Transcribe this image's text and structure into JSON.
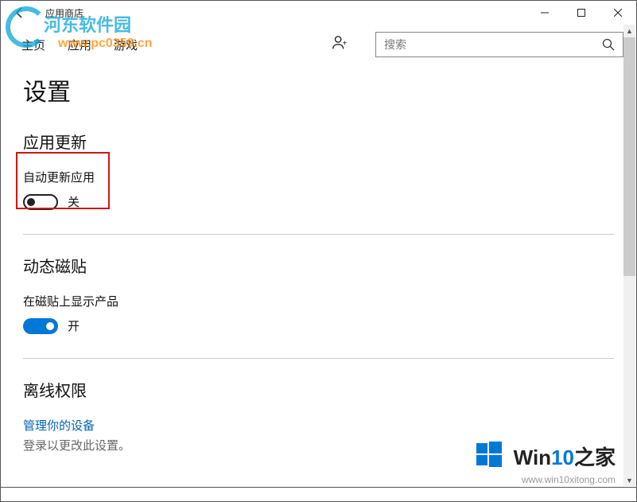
{
  "window": {
    "title": "应用商店"
  },
  "nav": {
    "home": "主页",
    "apps": "应用",
    "games": "游戏"
  },
  "search": {
    "placeholder": "搜索"
  },
  "page": {
    "title": "设置"
  },
  "sections": {
    "updates": {
      "title": "应用更新",
      "auto_update_label": "自动更新应用",
      "auto_update_state": "关"
    },
    "tiles": {
      "title": "动态磁贴",
      "show_products_label": "在磁贴上显示产品",
      "show_products_state": "开"
    },
    "offline": {
      "title": "离线权限",
      "manage_link": "管理你的设备",
      "signin_text": "登录以更改此设置。"
    }
  },
  "watermark_left": {
    "title": "河东软件园",
    "url": "www.pc0359.cn"
  },
  "watermark_right": {
    "title_pre": "Win",
    "title_hl": "10",
    "title_post": "之家",
    "url": "www.win10xitong.com"
  }
}
